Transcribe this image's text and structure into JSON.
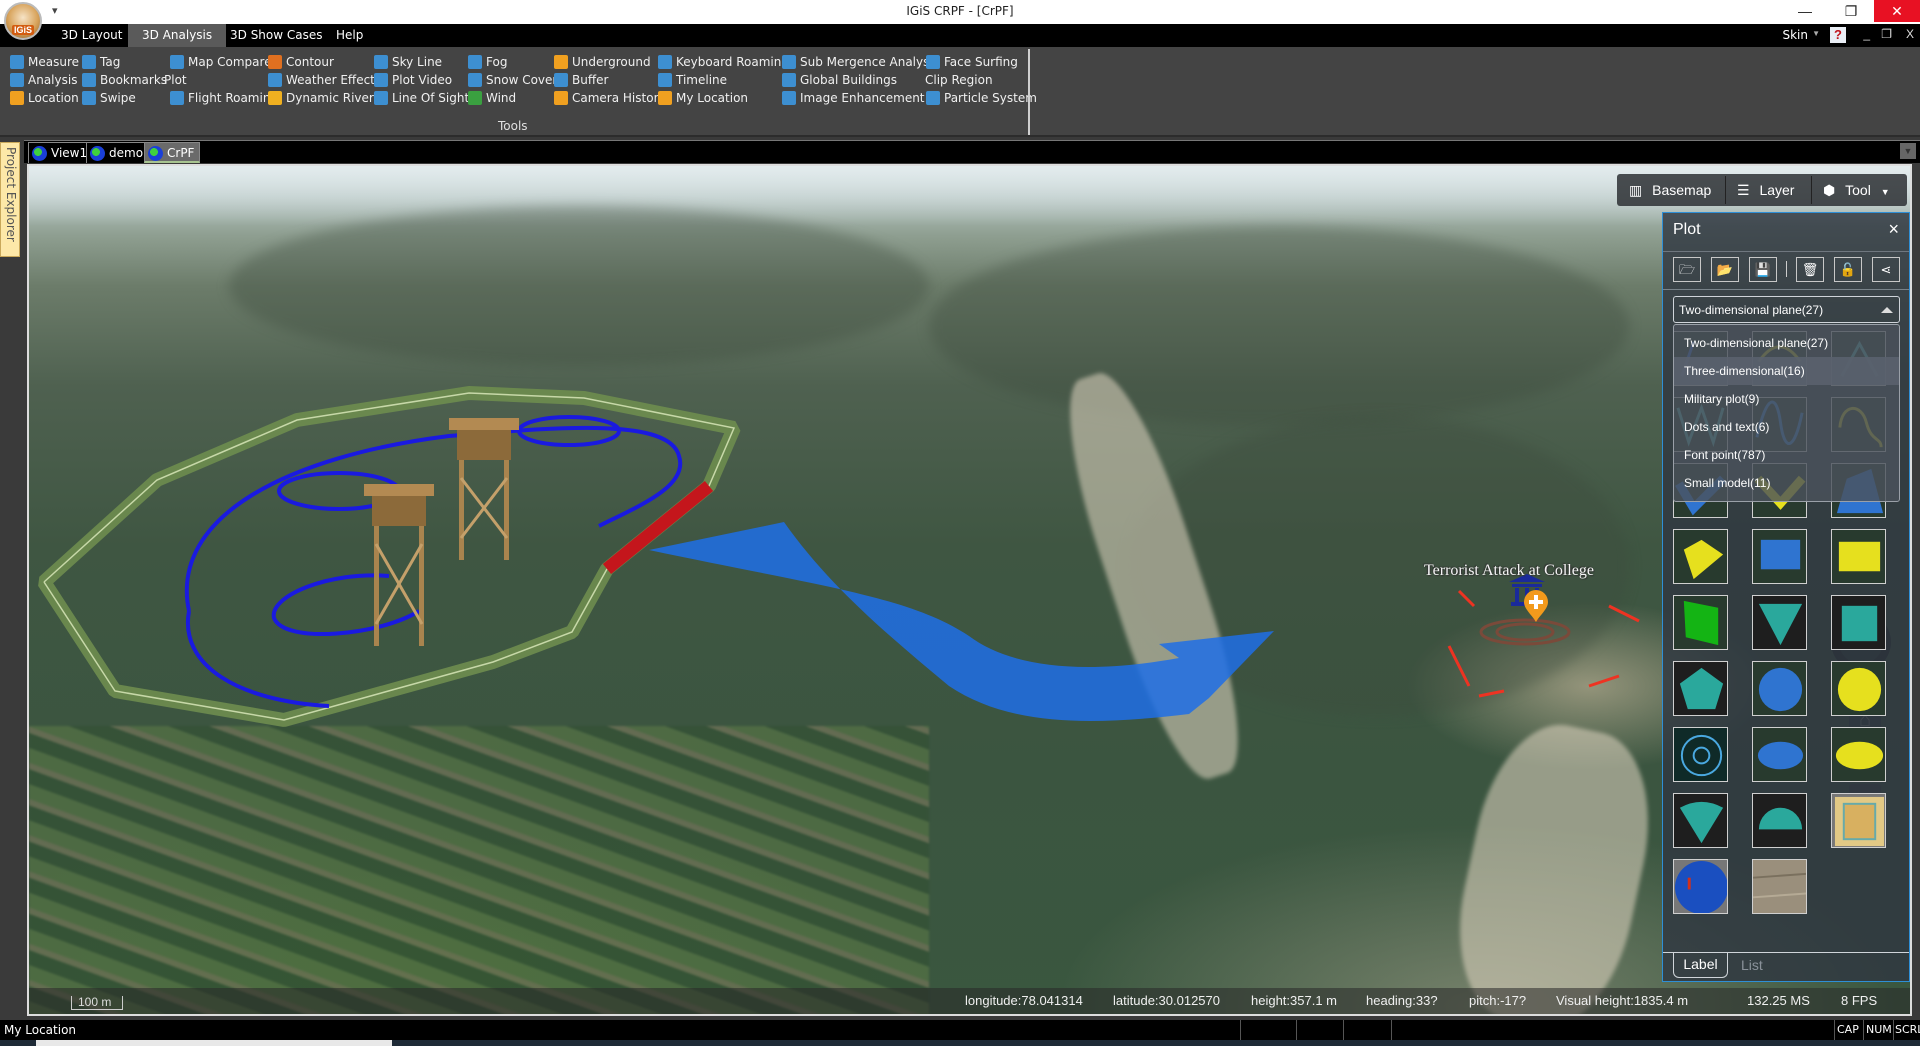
{
  "window": {
    "title": "IGiS CRPF - [CrPF]",
    "logo_text": "IGiS",
    "qat_icon": "customize-quick-access-icon",
    "controls": {
      "minimize": "—",
      "restore": "❐",
      "close": "✕"
    }
  },
  "menu": {
    "tabs": [
      {
        "label": "3D Layout",
        "active": false
      },
      {
        "label": "3D Analysis",
        "active": true
      },
      {
        "label": "3D Show Cases",
        "active": false
      },
      {
        "label": "Help",
        "active": false
      }
    ],
    "skin_label": "Skin",
    "help_label": "?",
    "mdi_controls": {
      "minimize": "_",
      "restore": "❐",
      "close": "X"
    }
  },
  "ribbon": {
    "group_label": "Tools",
    "items": [
      {
        "label": "Measure",
        "icon": "measure-icon",
        "color": "#3d8fd1"
      },
      {
        "label": "Analysis",
        "icon": "analysis-icon",
        "color": "#3d8fd1"
      },
      {
        "label": "Location",
        "icon": "location-pin-icon",
        "color": "#f0a020"
      },
      {
        "label": "Tag",
        "icon": "tag-pencil-icon",
        "color": "#3d8fd1"
      },
      {
        "label": "Bookmarks",
        "icon": "bookmark-icon",
        "color": "#3d8fd1"
      },
      {
        "label": "Swipe",
        "icon": "swipe-icon",
        "color": "#3d8fd1"
      },
      {
        "label": "Map Compare",
        "icon": "map-compare-icon",
        "color": "#3d8fd1"
      },
      {
        "label": "Plot",
        "icon": "",
        "color": ""
      },
      {
        "label": "Flight Roaming",
        "icon": "flight-icon",
        "color": "#3d8fd1"
      },
      {
        "label": "Contour",
        "icon": "contour-icon",
        "color": "#e07020"
      },
      {
        "label": "Weather Effects",
        "icon": "weather-icon",
        "color": "#3d8fd1"
      },
      {
        "label": "Dynamic River",
        "icon": "river-icon",
        "color": "#f0b020"
      },
      {
        "label": "Sky Line",
        "icon": "sky-line-icon",
        "color": "#3d8fd1"
      },
      {
        "label": "Plot Video",
        "icon": "video-icon",
        "color": "#3d8fd1"
      },
      {
        "label": "Line Of Sight",
        "icon": "line-of-sight-icon",
        "color": "#3d8fd1"
      },
      {
        "label": "Fog",
        "icon": "fog-icon",
        "color": "#3d8fd1"
      },
      {
        "label": "Snow Cover",
        "icon": "snow-icon",
        "color": "#3d8fd1"
      },
      {
        "label": "Wind",
        "icon": "wind-icon",
        "color": "#3aa040"
      },
      {
        "label": "Underground",
        "icon": "underground-icon",
        "color": "#f0a020"
      },
      {
        "label": "Buffer",
        "icon": "buffer-icon",
        "color": "#3d8fd1"
      },
      {
        "label": "Camera History",
        "icon": "camera-history-icon",
        "color": "#f0a020"
      },
      {
        "label": "Keyboard Roaming",
        "icon": "keyboard-icon",
        "color": "#3d8fd1"
      },
      {
        "label": "Timeline",
        "icon": "timeline-icon",
        "color": "#3d8fd1"
      },
      {
        "label": "My Location",
        "icon": "my-location-icon",
        "color": "#f0a020"
      },
      {
        "label": "Sub Mergence Analysis",
        "icon": "submergence-icon",
        "color": "#3d8fd1"
      },
      {
        "label": "Global Buildings",
        "icon": "buildings-icon",
        "color": "#3d8fd1"
      },
      {
        "label": "Image Enhancement",
        "icon": "image-enhancement-icon",
        "color": "#3d8fd1"
      },
      {
        "label": "Face Surfing",
        "icon": "face-surfing-icon",
        "color": "#3d8fd1"
      },
      {
        "label": "Clip Region",
        "icon": "",
        "color": ""
      },
      {
        "label": "Particle System",
        "icon": "particle-icon",
        "color": "#3d8fd1"
      }
    ]
  },
  "doc_tabs": [
    {
      "label": "View1",
      "active": false
    },
    {
      "label": "demo",
      "active": false
    },
    {
      "label": "CrPF",
      "active": true
    }
  ],
  "project_explorer_label": "Project Explorer",
  "map": {
    "poi_label": "Terrorist Attack at College",
    "scale_label": "100 m",
    "toolbar": {
      "basemap": "Basemap",
      "layer": "Layer",
      "tool": "Tool"
    },
    "status": {
      "longitude": "longitude:78.041314",
      "latitude": "latitude:30.012570",
      "height": "height:357.1 m",
      "heading": "heading:33?",
      "pitch": "pitch:-17?",
      "visual_height": "Visual height:1835.4 m",
      "frame_time": "132.25 MS",
      "fps": "8 FPS"
    },
    "nav": {
      "home": "⌂",
      "zoom_in": "+",
      "zoom_out": "−"
    }
  },
  "plot_panel": {
    "title": "Plot",
    "close": "×",
    "toolbar": [
      {
        "name": "open-file-button",
        "icon": "folder-open-outline-icon"
      },
      {
        "name": "open-folder-button",
        "icon": "folder-open-icon"
      },
      {
        "name": "save-button",
        "icon": "save-icon"
      },
      {
        "name": "delete-button",
        "icon": "trash-icon"
      },
      {
        "name": "unlock-button",
        "icon": "unlock-icon"
      },
      {
        "name": "share-button",
        "icon": "share-icon"
      }
    ],
    "category_selected": "Two-dimensional plane(27)",
    "category_options": [
      "Two-dimensional plane(27)",
      "Three-dimensional(16)",
      "Military plot(9)",
      "Dots and text(6)",
      "Font point(787)",
      "Small model(11)"
    ],
    "hovered_option": "Three-dimensional(16)",
    "symbols": [
      {
        "name": "straight-line",
        "shape": "line"
      },
      {
        "name": "arc-line",
        "shape": "arc"
      },
      {
        "name": "polyline-peak",
        "shape": "peak"
      },
      {
        "name": "zigzag-line",
        "shape": "zigzag"
      },
      {
        "name": "sine-curve",
        "shape": "sine"
      },
      {
        "name": "free-curve",
        "shape": "curve"
      },
      {
        "name": "blue-chevron",
        "shape": "chevron-blue"
      },
      {
        "name": "yellow-chevron",
        "shape": "chevron-yellow"
      },
      {
        "name": "blue-polygon",
        "shape": "polygon-blue"
      },
      {
        "name": "yellow-polygon",
        "shape": "polygon-yellow"
      },
      {
        "name": "blue-rectangle",
        "shape": "rect-blue"
      },
      {
        "name": "yellow-rectangle",
        "shape": "rect-yellow"
      },
      {
        "name": "green-quad",
        "shape": "quad-green"
      },
      {
        "name": "teal-triangle",
        "shape": "triangle-teal"
      },
      {
        "name": "teal-square",
        "shape": "square-teal"
      },
      {
        "name": "teal-pentagon",
        "shape": "pentagon-teal"
      },
      {
        "name": "blue-circle",
        "shape": "circle-blue"
      },
      {
        "name": "yellow-circle",
        "shape": "circle-yellow"
      },
      {
        "name": "ring-circle",
        "shape": "rings"
      },
      {
        "name": "blue-ellipse",
        "shape": "ellipse-blue"
      },
      {
        "name": "yellow-ellipse",
        "shape": "ellipse-yellow"
      },
      {
        "name": "teal-sector",
        "shape": "sector-teal"
      },
      {
        "name": "teal-semicircle",
        "shape": "semicircle-teal"
      },
      {
        "name": "map-image",
        "shape": "image-map"
      },
      {
        "name": "radar-circle",
        "shape": "radar"
      },
      {
        "name": "texture-image",
        "shape": "texture"
      }
    ],
    "tabs": {
      "label": "Label",
      "list": "List"
    }
  },
  "statusbar": {
    "text": "My Location",
    "indicators": [
      "CAP",
      "NUM",
      "SCRL"
    ]
  },
  "colors": {
    "ribbon_bg": "#444444",
    "accent_blue": "#2e8fd6",
    "teal": "#2aa89c",
    "plot_blue": "#2f74d0",
    "plot_yellow": "#e6e01e",
    "close_red": "#e81123"
  }
}
